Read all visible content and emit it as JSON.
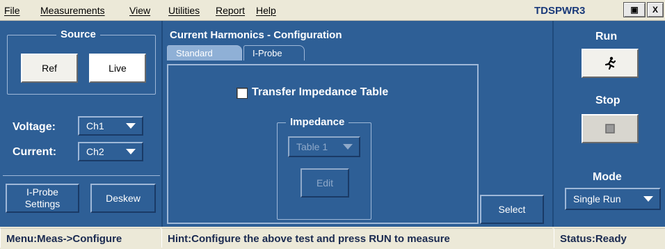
{
  "menu": {
    "items": [
      "File",
      "Measurements",
      "View",
      "Utilities",
      "Report",
      "Help"
    ],
    "app_title": "TDSPWR3",
    "minimize_glyph": "▣",
    "close_glyph": "X"
  },
  "source": {
    "title": "Source",
    "ref_label": "Ref",
    "live_label": "Live"
  },
  "voltage": {
    "label": "Voltage:",
    "value": "Ch1"
  },
  "current": {
    "label": "Current:",
    "value": "Ch2"
  },
  "bottom_left": {
    "iprobe_line1": "I-Probe",
    "iprobe_line2": "Settings",
    "deskew_label": "Deskew"
  },
  "config": {
    "title": "Current Harmonics - Configuration",
    "tabs": [
      "Standard",
      "I-Probe"
    ],
    "transfer_label": "Transfer Impedance Table",
    "transfer_checked": false,
    "impedance_title": "Impedance",
    "impedance_value": "Table 1",
    "edit_label": "Edit",
    "select_label": "Select"
  },
  "right": {
    "run_title": "Run",
    "run_icon": "running-man-icon",
    "stop_title": "Stop",
    "stop_icon": "stop-square-icon",
    "mode_title": "Mode",
    "mode_value": "Single Run"
  },
  "status": {
    "menu": "Menu:Meas->Configure",
    "hint": "Hint:Configure the above test and press RUN to measure",
    "state": "Status:Ready"
  }
}
